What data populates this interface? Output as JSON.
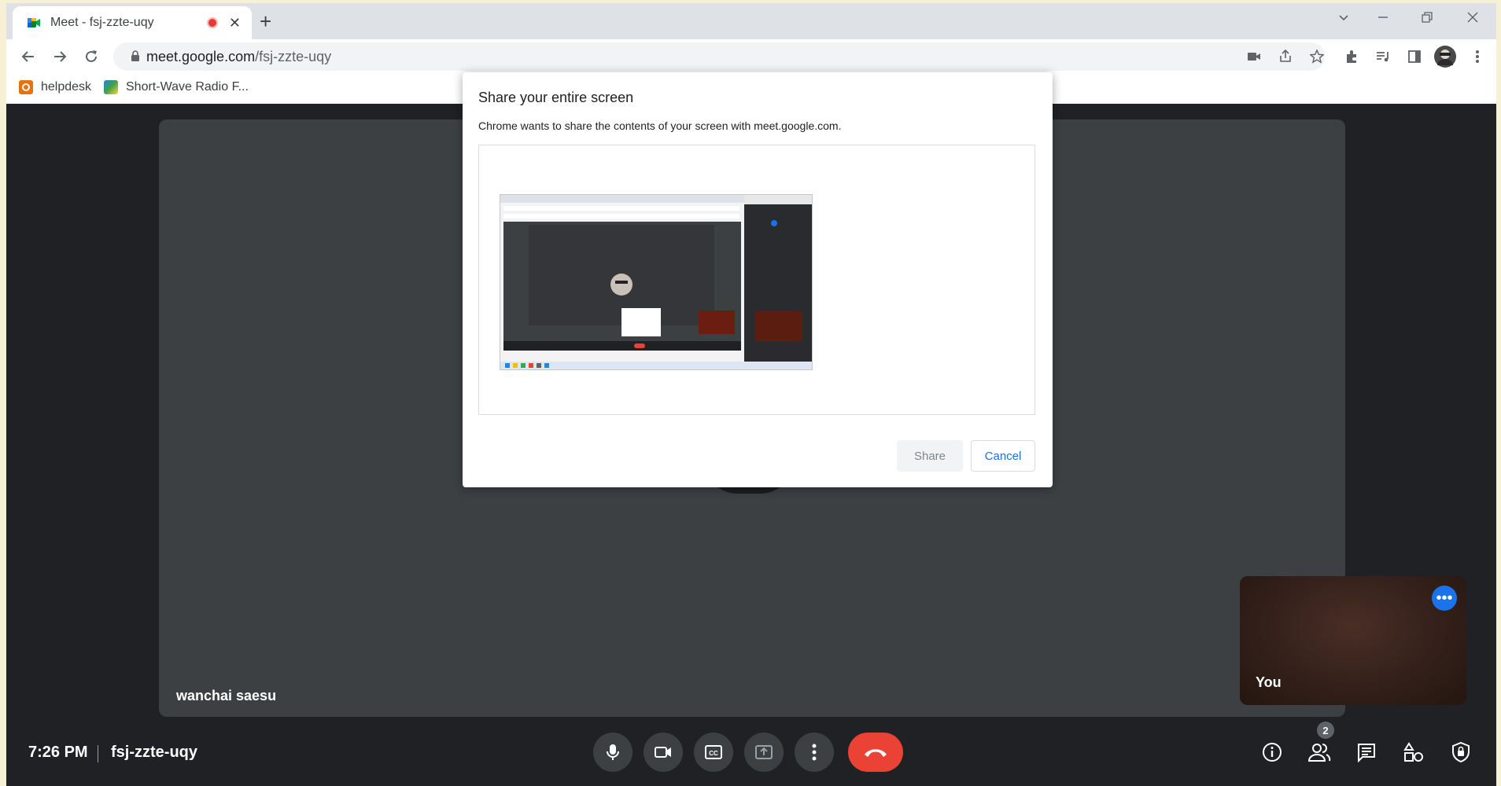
{
  "browser": {
    "tab_title": "Meet - fsj-zzte-uqy",
    "url_host": "meet.google.com",
    "url_path": "/fsj-zzte-uqy",
    "bookmarks": [
      {
        "label": "helpdesk",
        "color": "#e8710a"
      },
      {
        "label": "Short-Wave Radio F...",
        "color": "#1e88e5"
      }
    ]
  },
  "dialog": {
    "title": "Share your entire screen",
    "description": "Chrome wants to share the contents of your screen with meet.google.com.",
    "share_label": "Share",
    "cancel_label": "Cancel"
  },
  "meeting": {
    "participant_name": "wanchai saesu",
    "self_label": "You",
    "time": "7:26 PM",
    "code": "fsj-zzte-uqy",
    "people_count": "2",
    "controls": [
      "microphone-icon",
      "camera-icon",
      "captions-icon",
      "present-icon",
      "more-options-icon",
      "hangup-icon"
    ],
    "right_icons": [
      "info-icon",
      "people-icon",
      "chat-icon",
      "activities-icon",
      "host-controls-icon"
    ]
  },
  "colors": {
    "hangup": "#ea4335",
    "accent": "#1a73e8",
    "meet_bg": "#202124",
    "tile_bg": "#3c4043"
  }
}
